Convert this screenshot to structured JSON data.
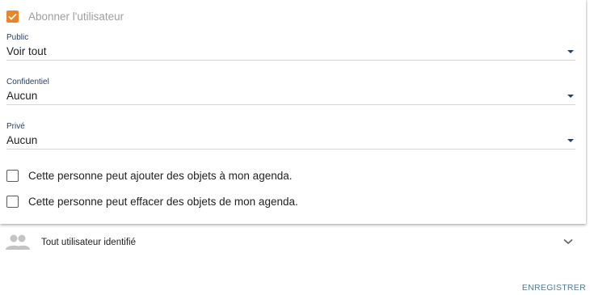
{
  "permissions": {
    "subscribe": {
      "label": "Abonner l'utilisateur",
      "checked": true
    },
    "fields": [
      {
        "label": "Public",
        "value": "Voir tout"
      },
      {
        "label": "Confidentiel",
        "value": "Aucun"
      },
      {
        "label": "Privé",
        "value": "Aucun"
      }
    ],
    "options": [
      {
        "label": "Cette personne peut ajouter des objets à mon agenda.",
        "checked": false
      },
      {
        "label": "Cette personne peut effacer des objets de mon agenda.",
        "checked": false
      }
    ]
  },
  "group": {
    "label": "Tout utilisateur identifié",
    "icon": "people-icon"
  },
  "actions": {
    "save_label": "ENREGISTRER"
  },
  "colors": {
    "accent": "#e8852a",
    "link": "#4d7a99",
    "label": "#23406e"
  }
}
